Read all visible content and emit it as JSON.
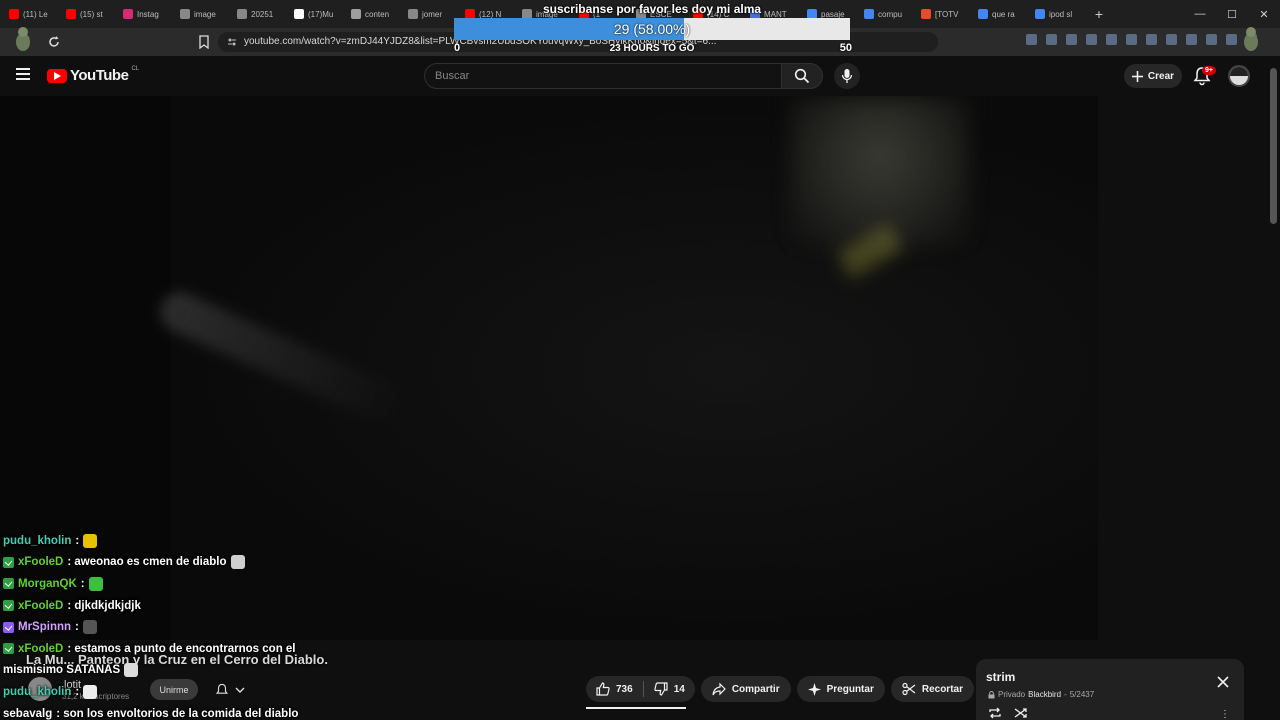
{
  "browser": {
    "tabs": [
      {
        "label": "(11) Le",
        "color": "#ff0000"
      },
      {
        "label": "(15) st",
        "color": "#ff0000"
      },
      {
        "label": "Instag",
        "color": "#d62976"
      },
      {
        "label": "image",
        "color": "#888888"
      },
      {
        "label": "20251",
        "color": "#888888"
      },
      {
        "label": "(17)Mu",
        "color": "#ffffff"
      },
      {
        "label": "conten",
        "color": "#9e9e9e"
      },
      {
        "label": "jomer",
        "color": "#888888"
      },
      {
        "label": "(12) N",
        "color": "#ff0000"
      },
      {
        "label": "image",
        "color": "#888888"
      },
      {
        "label": "(1",
        "color": "#ff0000"
      },
      {
        "label": "ESCE",
        "color": "#888888"
      },
      {
        "label": "(14) C",
        "color": "#ff0000"
      },
      {
        "label": "MANT",
        "color": "#4a6fdc"
      },
      {
        "label": "pasaje",
        "color": "#4285f4"
      },
      {
        "label": "compu",
        "color": "#4285f4"
      },
      {
        "label": "[TOTV",
        "color": "#e54b2c"
      },
      {
        "label": "que ra",
        "color": "#4285f4"
      },
      {
        "label": "ipod sl",
        "color": "#4285f4"
      }
    ],
    "new_tab": "+",
    "address": "youtube.com/watch?v=zmDJ44YJDZ8&list=PLWCBvsm2UbdSOKYouvqWxy_BoSHylkKh0&index=5&t=6..."
  },
  "goal_widget": {
    "title": "suscribanse por favor les doy mi alma",
    "progress_text": "29 (58.00%)",
    "fraction": 0.58,
    "min": "0",
    "max": "50",
    "time_left": "23 HOURS TO GO"
  },
  "header": {
    "logo": "YouTube",
    "country_code": "CL",
    "search_placeholder": "Buscar",
    "create_label": "Crear",
    "notif_badge": "9+"
  },
  "chat": [
    {
      "user": "pudu_kholin",
      "color": "#3fd0b3",
      "badge": "",
      "msg": ":",
      "emote": "#e6c200"
    },
    {
      "user": "xFooleD",
      "color": "#5ed32c",
      "badge": "green",
      "msg": ": aweonao es cmen de diablo",
      "emote": "#cfcfcf"
    },
    {
      "user": "MorganQK",
      "color": "#5ed32c",
      "badge": "green",
      "msg": ":",
      "emote": "#3fbf3f"
    },
    {
      "user": "xFooleD",
      "color": "#5ed32c",
      "badge": "green",
      "msg": ": djkdkjdkjdjk",
      "emote": ""
    },
    {
      "user": "MrSpinnn",
      "color": "#d3a2ff",
      "badge": "purple",
      "msg": ":",
      "emote": "#555555"
    },
    {
      "user": "xFooleD",
      "color": "#5ed32c",
      "badge": "green",
      "msg": ": estamos a punto de encontrarnos con el",
      "emote": ""
    },
    {
      "user": "",
      "color": "#ffffff",
      "badge": "",
      "msg": "mismisimo SATANAS",
      "emote": "#dddddd"
    },
    {
      "user": "pudu_kholin",
      "color": "#3fd0b3",
      "badge": "",
      "msg": ":",
      "emote": "#eeeeee"
    },
    {
      "user": "sebavalg",
      "color": "#ffffff",
      "badge": "",
      "msg": ": son los envoltorios de la comida del diablo",
      "emote": ""
    }
  ],
  "video": {
    "title": "La Mu... Panteon y la Cruz en el Cerro del Diablo.",
    "channel": "lotit",
    "subscribers": "31,2 k suscriptores",
    "join_label": "Unirme",
    "likes": "736",
    "dislikes": "14",
    "share_label": "Compartir",
    "ask_label": "Preguntar",
    "clip_label": "Recortar"
  },
  "playlist": {
    "title": "strim",
    "privacy": "Privado",
    "owner": "Blackbird",
    "position": "5/2437"
  }
}
